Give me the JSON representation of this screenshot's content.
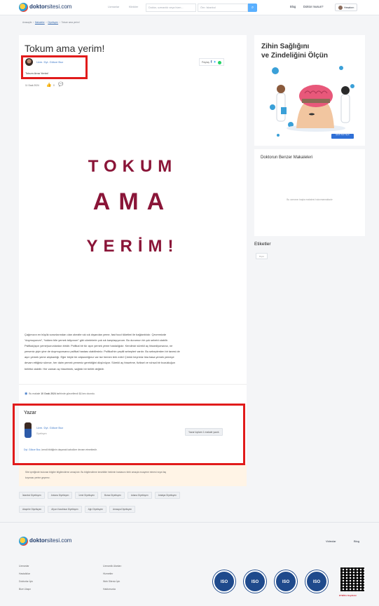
{
  "header": {
    "logo_bold": "doktor",
    "logo_light": "sitesi.com",
    "tabs": [
      "Uzmanlar",
      "Klinikler"
    ],
    "search_placeholder": "Doktor, uzmanlık veya hizm...",
    "city_placeholder": "Örn: İstanbul",
    "links": [
      "Blog",
      "Doktor musun?"
    ],
    "login_label": "Hesabım"
  },
  "breadcrumb": [
    "Anasayfa",
    "Makaleler",
    "Diyetisyen",
    "Tokum ama yerim!"
  ],
  "article": {
    "title": "Tokum ama yerim!",
    "author": "Uzm. Dyt. Gökce Boz",
    "subtitle": "Tokum Ama Yerim!",
    "date": "11 Ocak 2024",
    "likes": "0",
    "share_label": "Paylaş",
    "hero_words": [
      "TOKUM",
      "AMA",
      "YERİM!"
    ],
    "body_lines": [
      "Çağımızın en büyük sorunlarından olan obezite sık sık dışarıdan yeme, fast food tüketimi ile bağlantılıdır. Çevremizde",
      "“doymuyorum”, “tokken bile yemek istiyorum” gibi cümlelerle çok sık karşılaşıyorum. Bu durumun bir çok sebebi olabilir.",
      "Psifikal(aşırı yeme)sorunlardan biridir. Psifikal bir tür aşırı yemek yeme hastalığıdır. Kendinizi sürekli aç hissediyorsanız, ne",
      "yerseniz yiyin yine de doymuyorsanız psifikal hastası olabilirsiniz. Psifikal'nin çeşitli sebepleri vardır. Bu sebeplerden bir tanesi de",
      "aşırı yemek yeme alışkanlığı. Eğer böyle bir alışkanlığınız var ise hemen terk edin! Çünkü beyniniz tıka basa yemek yemeye",
      "devam ettiğiniz sürece, her daim yemek yemeniz gerektiğini düşünüyor. Sürekli aç hissetme, fiziksel ve ruhsal bir bozukluğun",
      "belirtisi olabilir. Her zaman aç hissetmek, sağlıklı bir belirti değildir."
    ],
    "update_prefix": "Bu makale",
    "update_date": "10 Ocak 2024",
    "update_mid": "tarihinde güncellendi",
    "update_count": "11",
    "update_suffix": "kez okundu."
  },
  "author_box": {
    "heading": "Yazar",
    "name": "Uzm. Dyt. Gökce Boz",
    "role": "Diyetisyen",
    "articles_button": "Yazar toplam 1 makale yazdı.",
    "note_link": "Dyt. Gökce Boz",
    "note_rest": ", kendi bildiğinin dayanak kabulüne devam etmektedir."
  },
  "disclaimer": [
    "Site içeriğinde bulunan bilgiler bilgilendirme amaçlıdır. Bu bilgilendirme kesinlikle hekimin hastasını tıbbi amaçla muayene etmesi veya ilaç",
    "koyması yerine geçmez."
  ],
  "tags_row1": [
    "İstanbul Diyetisyen",
    "Ankara Diyetisyen",
    "İzmir Diyetisyen",
    "Bursa Diyetisyen",
    "Adana Diyetisyen",
    "Antalya Diyetisyen"
  ],
  "tags_row2": [
    "Ataşehir Diyetisyen",
    "Afyon Karahisar Diyetisyen",
    "Ağrı Diyetisyen",
    "Amasya Diyetisyen"
  ],
  "sidebar": {
    "ad_title_1": "Zihin Sağlığını",
    "ad_title_2": "ve Zindeliğini Ölçün",
    "ad_button": "Şimdi Testi Yapın",
    "related_heading": "Doktorun Benzer Makaleleri",
    "related_empty": "Bu uzmanın başka makalesi bulunmamaktadır",
    "tags_heading": "Etiketler",
    "tag": "Diyet"
  },
  "footer": {
    "nav": [
      "Videolar",
      "Blog"
    ],
    "col1": [
      "Uzmanlar",
      "Hastalıklar",
      "Doktorlar İçin",
      "Bize Ulaşın"
    ],
    "col2": [
      "Uzmanlık Alanları",
      "Hizmetler",
      "Web Siteniz İçin",
      "Hakkımızda"
    ],
    "iso_labels": [
      "ISO",
      "ISO",
      "ISO",
      "ISO"
    ],
    "etbis_label": "ETBİS'e Kayıtlıdır"
  },
  "colors": {
    "accent": "#3d78c8",
    "hero_text": "#8a1538",
    "highlight_border": "#e11b1b",
    "search_button": "#5ab0ff"
  }
}
